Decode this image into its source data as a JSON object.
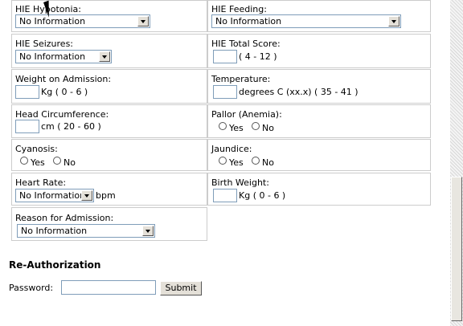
{
  "fields": {
    "hie_hypotonia": {
      "label": "HIE Hypotonia:",
      "value": "No Information"
    },
    "hie_feeding": {
      "label": "HIE Feeding:",
      "value": "No Information"
    },
    "hie_seizures": {
      "label": "HIE Seizures:",
      "value": "No Information"
    },
    "hie_total_score": {
      "label": "HIE Total Score:",
      "hint": "( 4 - 12 )"
    },
    "weight_on_admission": {
      "label": "Weight on Admission:",
      "hint": "Kg ( 0 - 6 )"
    },
    "temperature": {
      "label": "Temperature:",
      "hint": "degrees C (xx.x) ( 35 - 41 )"
    },
    "head_circumference": {
      "label": "Head Circumference:",
      "hint": "cm ( 20 - 60 )"
    },
    "pallor": {
      "label": "Pallor (Anemia):",
      "yes": "Yes",
      "no": "No"
    },
    "cyanosis": {
      "label": "Cyanosis:",
      "yes": "Yes",
      "no": "No"
    },
    "jaundice": {
      "label": "Jaundice:",
      "yes": "Yes",
      "no": "No"
    },
    "heart_rate": {
      "label": "Heart Rate:",
      "value": "No Information",
      "unit": "bpm"
    },
    "birth_weight": {
      "label": "Birth Weight:",
      "hint": "Kg ( 0 - 6 )"
    },
    "reason_for_admission": {
      "label": "Reason for Admission:",
      "value": "No Information"
    }
  },
  "reauth": {
    "heading": "Re-Authorization",
    "password_label": "Password:",
    "submit_label": "Submit"
  }
}
